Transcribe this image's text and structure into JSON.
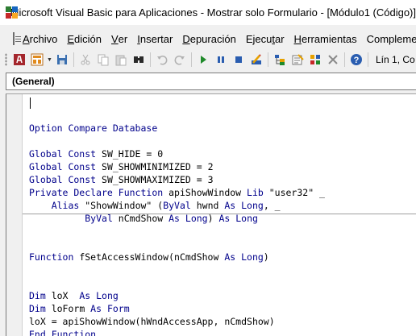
{
  "window": {
    "title": "Microsoft Visual Basic para Aplicaciones - Mostrar solo Formulario - [Módulo1 (Código)]",
    "icon_colors": [
      "#2e7d32",
      "#1565c0",
      "#c62828",
      "#f9a825"
    ]
  },
  "menubar": {
    "items": [
      {
        "label": "Archivo",
        "accel": "A",
        "rest": "rchivo"
      },
      {
        "label": "Edición",
        "accel": "E",
        "rest": "dición"
      },
      {
        "label": "Ver",
        "accel": "V",
        "rest": "er"
      },
      {
        "label": "Insertar",
        "accel": "I",
        "rest": "nsertar"
      },
      {
        "label": "Depuración",
        "accel": "D",
        "rest": "epuración"
      },
      {
        "label": "Ejecutar",
        "pre": "Ejecu",
        "accel": "t",
        "rest": "ar"
      },
      {
        "label": "Herramientas",
        "accel": "H",
        "rest": "erramientas"
      },
      {
        "label": "Complementos",
        "text": "Compleme"
      }
    ]
  },
  "toolbar": {
    "cursor_position": "Lín 1, Co",
    "icons": [
      "access-icon",
      "insert-module-icon",
      "save-icon",
      "cut-icon",
      "copy-icon",
      "paste-icon",
      "find-icon",
      "undo-icon",
      "redo-icon",
      "run-icon",
      "break-icon",
      "reset-icon",
      "design-mode-icon",
      "project-explorer-icon",
      "properties-icon",
      "object-browser-icon",
      "toolbox-icon",
      "help-icon"
    ]
  },
  "object_box": {
    "value": "(General)"
  },
  "code": {
    "lines": [
      {
        "text": "",
        "line": 0
      },
      {
        "line": 1,
        "tokens": [
          {
            "t": "Option Compare Database",
            "k": true
          }
        ]
      },
      {
        "line": 3,
        "tokens": [
          {
            "t": "Global Const",
            "k": true
          },
          {
            "t": " SW_HIDE = 0"
          }
        ]
      },
      {
        "line": 4,
        "tokens": [
          {
            "t": "Global Const",
            "k": true
          },
          {
            "t": " SW_SHOWMINIMIZED = 2"
          }
        ]
      },
      {
        "line": 5,
        "tokens": [
          {
            "t": "Global Const",
            "k": true
          },
          {
            "t": " SW_SHOWMAXIMIZED = 3"
          }
        ]
      },
      {
        "line": 6,
        "tokens": [
          {
            "t": "Private Declare Function",
            "k": true
          },
          {
            "t": " apiShowWindow "
          },
          {
            "t": "Lib",
            "k": true
          },
          {
            "t": " \"user32\" _"
          }
        ]
      },
      {
        "line": 7,
        "tokens": [
          {
            "t": "    "
          },
          {
            "t": "Alias",
            "k": true
          },
          {
            "t": " \"ShowWindow\" ("
          },
          {
            "t": "ByVal",
            "k": true
          },
          {
            "t": " hwnd "
          },
          {
            "t": "As Long",
            "k": true
          },
          {
            "t": ", _"
          }
        ]
      },
      {
        "line": 8,
        "tokens": [
          {
            "t": "          "
          },
          {
            "t": "ByVal",
            "k": true
          },
          {
            "t": " nCmdShow "
          },
          {
            "t": "As Long",
            "k": true
          },
          {
            "t": ") "
          },
          {
            "t": "As Long",
            "k": true
          }
        ]
      },
      {
        "line": 11,
        "tokens": [
          {
            "t": "Function",
            "k": true
          },
          {
            "t": " fSetAccessWindow(nCmdShow "
          },
          {
            "t": "As Long",
            "k": true
          },
          {
            "t": ")"
          }
        ]
      },
      {
        "line": 14,
        "tokens": [
          {
            "t": "Dim",
            "k": true
          },
          {
            "t": " loX  "
          },
          {
            "t": "As Long",
            "k": true
          }
        ]
      },
      {
        "line": 15,
        "tokens": [
          {
            "t": "Dim",
            "k": true
          },
          {
            "t": " loForm "
          },
          {
            "t": "As Form",
            "k": true
          }
        ]
      },
      {
        "line": 16,
        "tokens": [
          {
            "t": "loX = apiShowWindow(hWndAccessApp, nCmdShow)"
          }
        ]
      },
      {
        "line": 17,
        "tokens": [
          {
            "t": "End Function",
            "k": true
          }
        ]
      }
    ],
    "keyword_color": "#00008b"
  }
}
